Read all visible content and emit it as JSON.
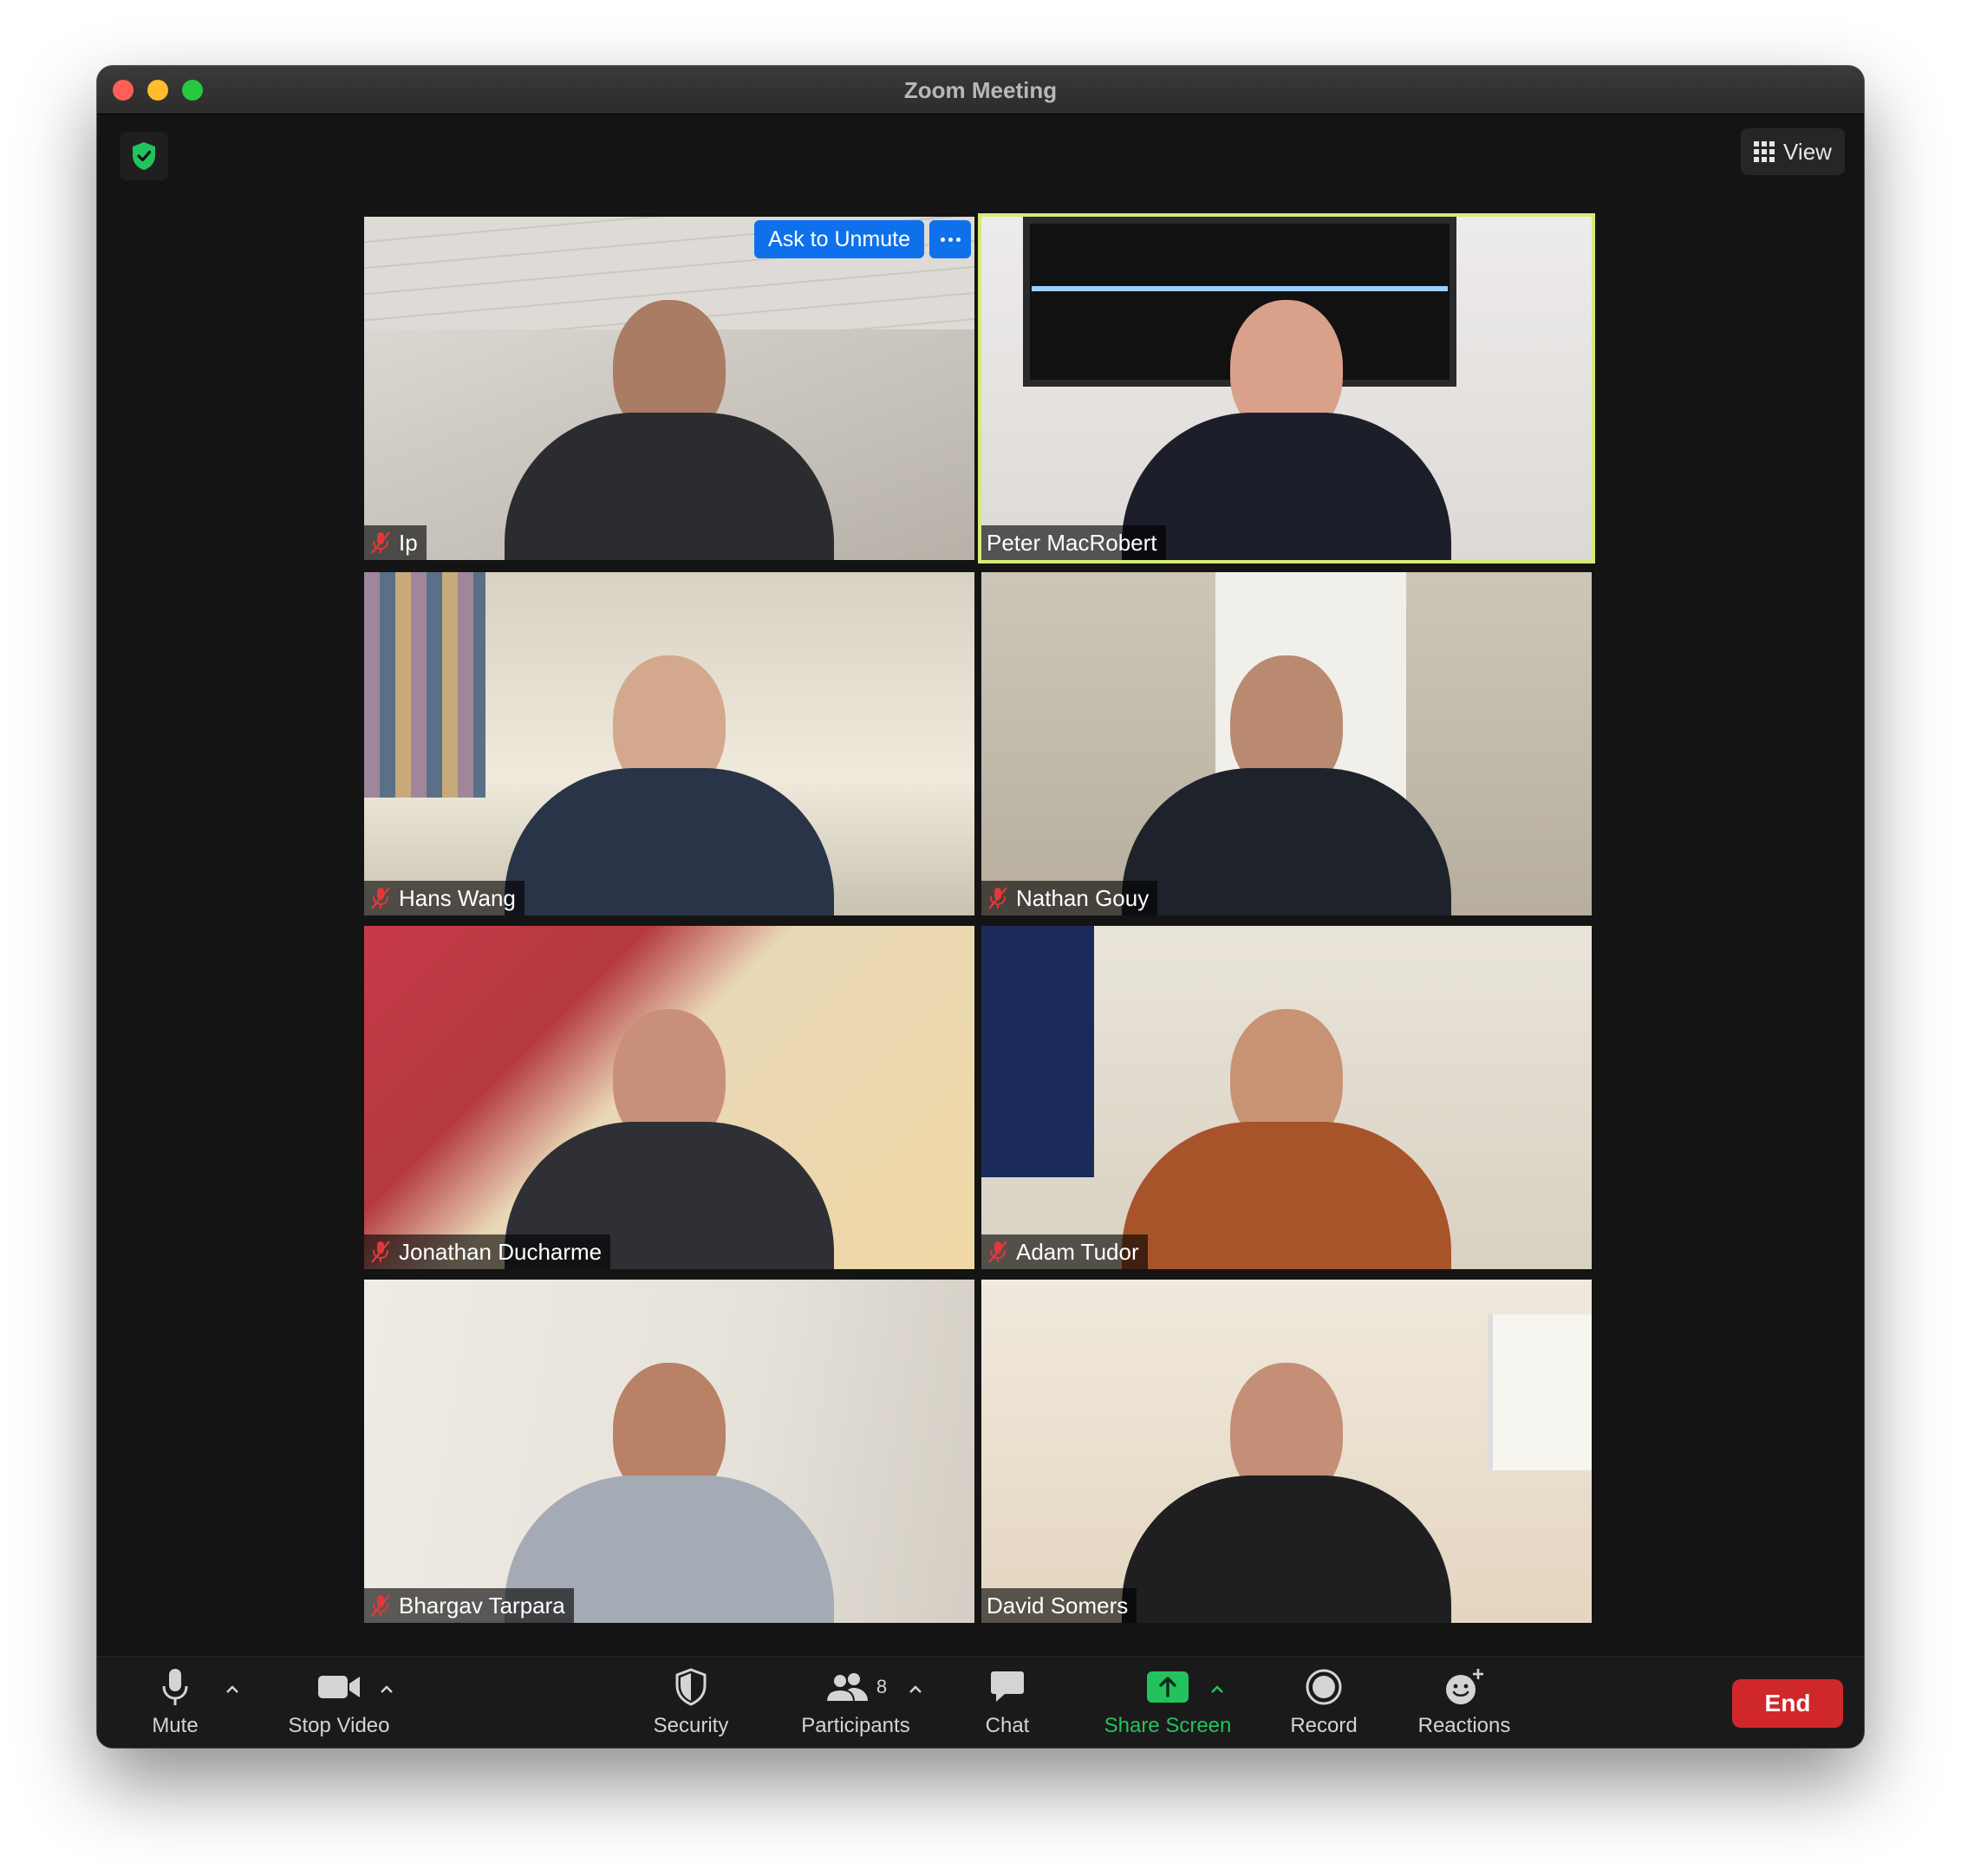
{
  "window": {
    "title": "Zoom Meeting"
  },
  "top": {
    "view_label": "View"
  },
  "tiles": [
    {
      "name": "Ip",
      "muted": true
    },
    {
      "name": "Peter MacRobert",
      "muted": false
    },
    {
      "name": "Hans Wang",
      "muted": true
    },
    {
      "name": "Nathan Gouy",
      "muted": true
    },
    {
      "name": "Jonathan Ducharme",
      "muted": true
    },
    {
      "name": "Adam Tudor",
      "muted": true
    },
    {
      "name": "Bhargav Tarpara",
      "muted": true
    },
    {
      "name": "David Somers",
      "muted": false
    }
  ],
  "hover_actions": {
    "ask_to_unmute": "Ask to Unmute"
  },
  "toolbar": {
    "mute": "Mute",
    "stop_video": "Stop Video",
    "security": "Security",
    "participants": "Participants",
    "participants_count": "8",
    "chat": "Chat",
    "share_screen": "Share Screen",
    "record": "Record",
    "reactions": "Reactions",
    "end": "End"
  },
  "colors": {
    "accent_blue": "#0e71eb",
    "share_green": "#22c35c",
    "end_red": "#d0282a",
    "speaker_outline": "#d6ea76",
    "shield_green": "#22c35c",
    "muted_red": "#e0383b"
  }
}
